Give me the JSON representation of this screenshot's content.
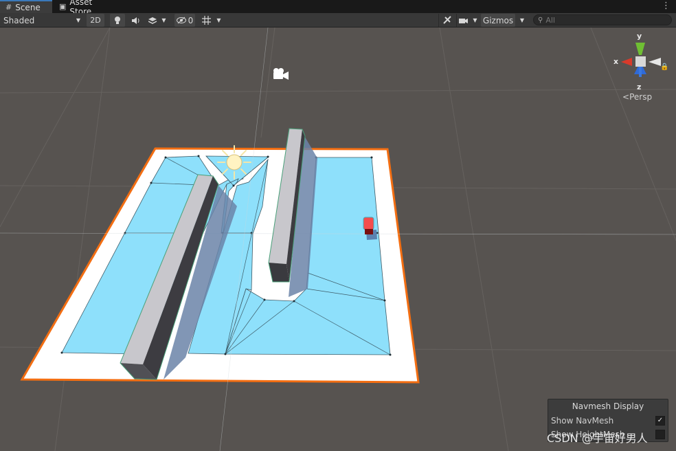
{
  "tabs": [
    {
      "label": "Scene",
      "icon": "grid-icon",
      "active": true
    },
    {
      "label": "Asset Store",
      "icon": "store-bag-icon",
      "active": false
    }
  ],
  "toolbar": {
    "shading_mode": "Shaded",
    "btn_2d": "2D",
    "hidden_count": "0",
    "gizmos_label": "Gizmos",
    "search_placeholder": "All"
  },
  "gizmo": {
    "x": "x",
    "y": "y",
    "z": "z",
    "projection": "Persp"
  },
  "navmesh_display": {
    "title": "Navmesh Display",
    "show_navmesh_label": "Show NavMesh",
    "show_navmesh_checked": true,
    "second_option_label": "Show HeightMesh"
  },
  "watermark": "CSDN @宇宙好男人",
  "colors": {
    "navmesh": "#8ee0fb",
    "selection": "#f36e12",
    "plane": "#ffffff",
    "background": "#575350"
  }
}
